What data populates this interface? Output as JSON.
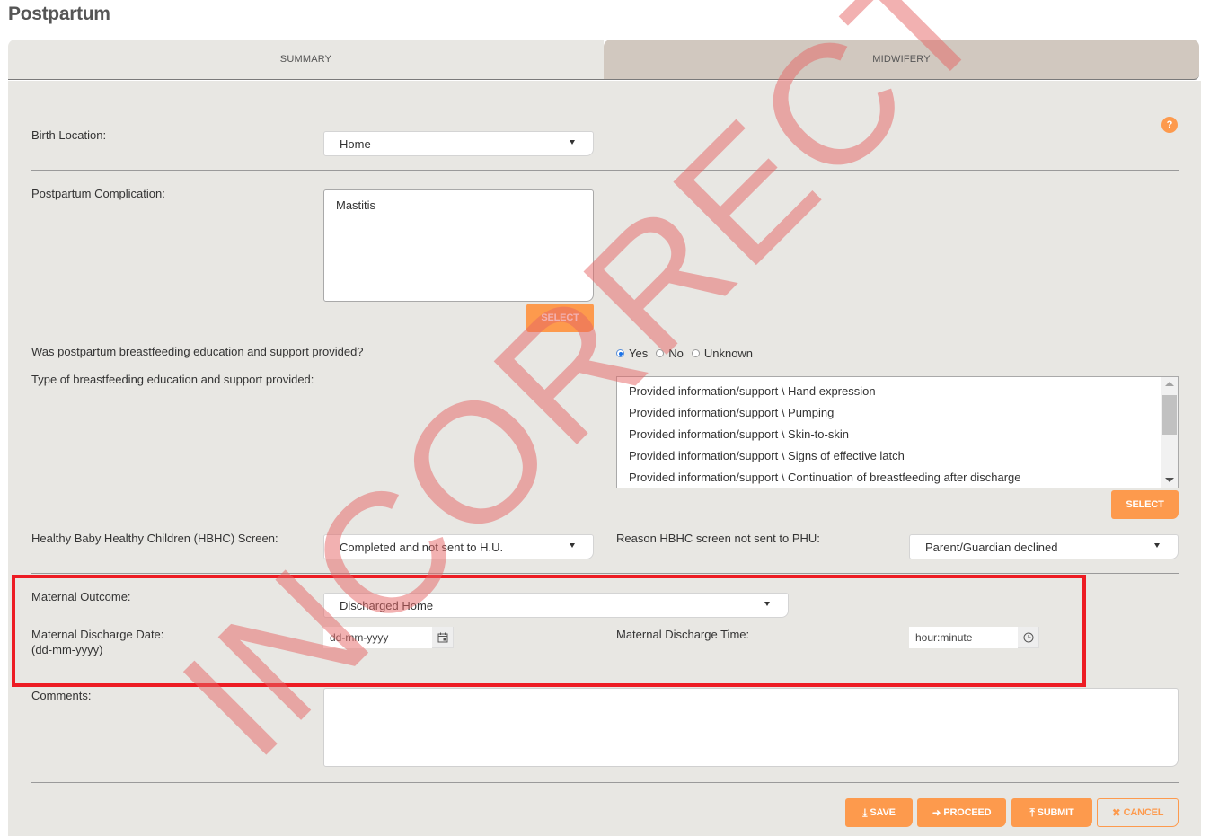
{
  "page": {
    "title": "Postpartum"
  },
  "tabs": [
    {
      "label": "SUMMARY",
      "active": false
    },
    {
      "label": "MIDWIFERY",
      "active": true
    }
  ],
  "help": {
    "icon": "question-circle-icon",
    "glyph": "?"
  },
  "form": {
    "birth_location": {
      "label": "Birth Location:",
      "value": "Home"
    },
    "postpartum_complication": {
      "label": "Postpartum Complication:",
      "value": "Mastitis",
      "select_label": "SELECT"
    },
    "breastfeeding_provided": {
      "label": "Was postpartum breastfeeding education and support provided?",
      "options": [
        "Yes",
        "No",
        "Unknown"
      ],
      "selected": "Yes"
    },
    "breastfeeding_type": {
      "label": "Type of breastfeeding education and support provided:",
      "items": [
        "Provided information/support \\ Hand expression",
        "Provided information/support \\ Pumping",
        "Provided information/support \\ Skin-to-skin",
        "Provided information/support \\ Signs of effective latch",
        "Provided information/support \\ Continuation of breastfeeding after discharge"
      ],
      "select_label": "SELECT"
    },
    "hbhc_screen": {
      "label": "Healthy Baby Healthy Children (HBHC) Screen:",
      "value": "Completed and not sent to H.U."
    },
    "hbhc_reason": {
      "label": "Reason HBHC screen not sent to PHU:",
      "value": "Parent/Guardian declined"
    },
    "maternal_outcome": {
      "label": "Maternal Outcome:",
      "value": "Discharged Home"
    },
    "maternal_discharge_date": {
      "label": "Maternal Discharge Date:",
      "sublabel": "(dd-mm-yyyy)",
      "placeholder": "dd-mm-yyyy",
      "value": ""
    },
    "maternal_discharge_time": {
      "label": "Maternal Discharge Time:",
      "placeholder": "hour:minute",
      "value": ""
    },
    "comments": {
      "label": "Comments:",
      "value": ""
    }
  },
  "actions": {
    "save": "SAVE",
    "proceed": "PROCEED",
    "submit": "SUBMIT",
    "cancel": "CANCEL"
  },
  "overlay": {
    "watermark": "INCORRECT",
    "watermark_color": "#e66464",
    "highlight_color": "#ed1c24"
  },
  "colors": {
    "accent": "#fd9a4d",
    "panel_bg": "#e8e7e3",
    "active_tab_bg": "#d1c8bf"
  }
}
